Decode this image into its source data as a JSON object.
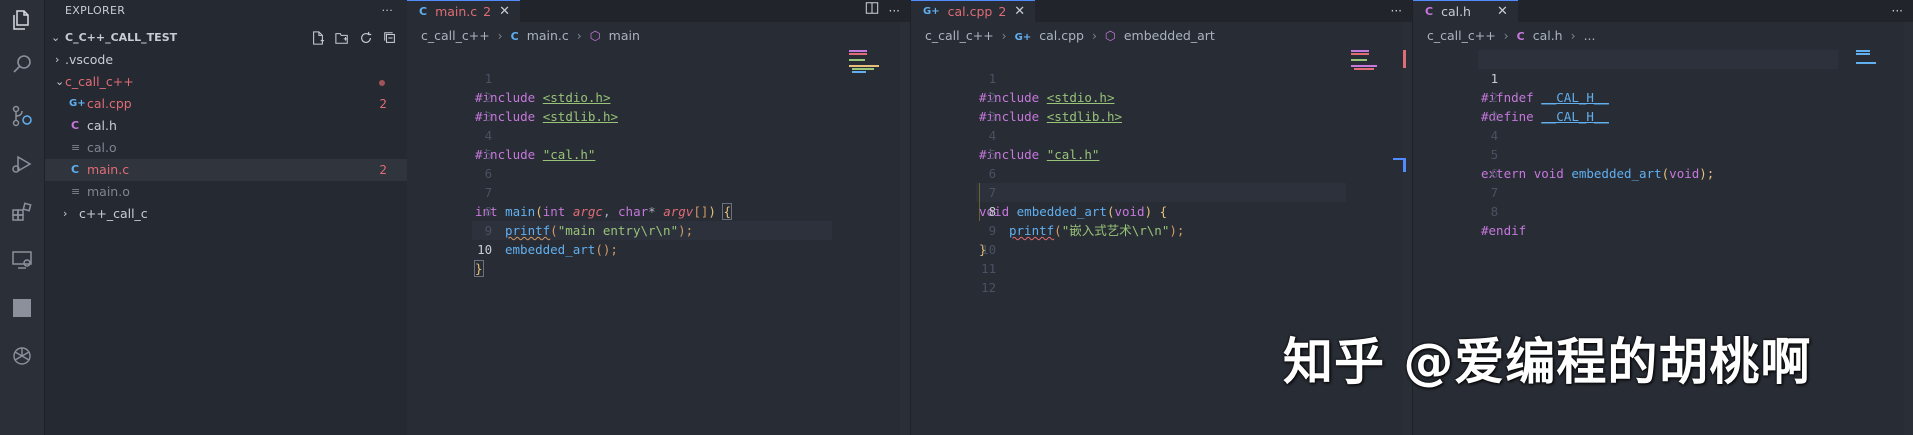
{
  "colors": {
    "error": "#e06c75",
    "accent": "#528bff",
    "keyword": "#c678dd",
    "function": "#61afef",
    "string": "#98c379"
  },
  "activity_bar": [
    "files-icon",
    "search-icon",
    "source-control-icon",
    "run-debug-icon",
    "extensions-icon",
    "remote-explorer-icon",
    "square-icon",
    "openai-icon"
  ],
  "sidebar": {
    "title": "EXPLORER",
    "more": "···",
    "project": "C_C++_CALL_TEST",
    "items": [
      {
        "label": ".vscode",
        "chevron": "›"
      },
      {
        "label": "c_call_c++",
        "chevron": "⌄"
      },
      {
        "label": "cal.cpp",
        "icon": "G+",
        "badge": "2"
      },
      {
        "label": "cal.h",
        "icon": "C"
      },
      {
        "label": "cal.o",
        "icon": "≡"
      },
      {
        "label": "main.c",
        "icon": "C",
        "badge": "2"
      },
      {
        "label": "main.o",
        "icon": "≡"
      },
      {
        "label": "c++_call_c",
        "chevron": "›"
      }
    ]
  },
  "editors": {
    "left": {
      "tab": {
        "icon": "C",
        "label": "main.c",
        "count": "2",
        "close": "✕"
      },
      "crumbs": {
        "folder": "c_call_c++",
        "file": "main.c",
        "symbol": "main"
      },
      "lines": [
        "1",
        "2",
        "3",
        "4",
        "5",
        "6",
        "7",
        "8",
        "9",
        "10"
      ]
    },
    "middle": {
      "tab": {
        "icon": "G+",
        "label": "cal.cpp",
        "count": "2",
        "close": "✕"
      },
      "crumbs": {
        "folder": "c_call_c++",
        "file": "cal.cpp",
        "symbol": "embedded_art"
      },
      "lines": [
        "1",
        "2",
        "3",
        "4",
        "5",
        "6",
        "7",
        "8",
        "9",
        "10",
        "11",
        "12"
      ]
    },
    "right": {
      "tab": {
        "icon": "C",
        "label": "cal.h",
        "close": "✕"
      },
      "crumbs": {
        "folder": "c_call_c++",
        "file": "cal.h",
        "symbol": "..."
      },
      "lines": [
        "1",
        "2",
        "3",
        "4",
        "5",
        "6",
        "7",
        "8"
      ]
    },
    "more": "···"
  },
  "code": {
    "include": "#include",
    "stdio": "<stdio.h>",
    "stdlib": "<stdlib.h>",
    "calh": "\"cal.h\"",
    "int": "int",
    "main": "main",
    "paren_open": "(",
    "int2": "int",
    "argc": "argc",
    "comma": ", ",
    "char": "char",
    "star": "* ",
    "argv": "argv",
    "brackets": "[]",
    "paren_close": ")",
    "brace_open": "{",
    "printf": "printf",
    "main_entry": "\"main entry\\r\\n\"",
    "semi": ");",
    "embedded_art": "embedded_art",
    "call_empty": "();",
    "brace_close": "}",
    "void": "void",
    "void2": "void",
    "cn_string": "\"嵌入式艺术\\r\\n\"",
    "ifndef": "#ifndef",
    "guard": "__CAL_H__",
    "define": "#define",
    "extern": "extern",
    "endif": "#endif"
  },
  "watermark": "知乎 @爱编程的胡桃啊"
}
